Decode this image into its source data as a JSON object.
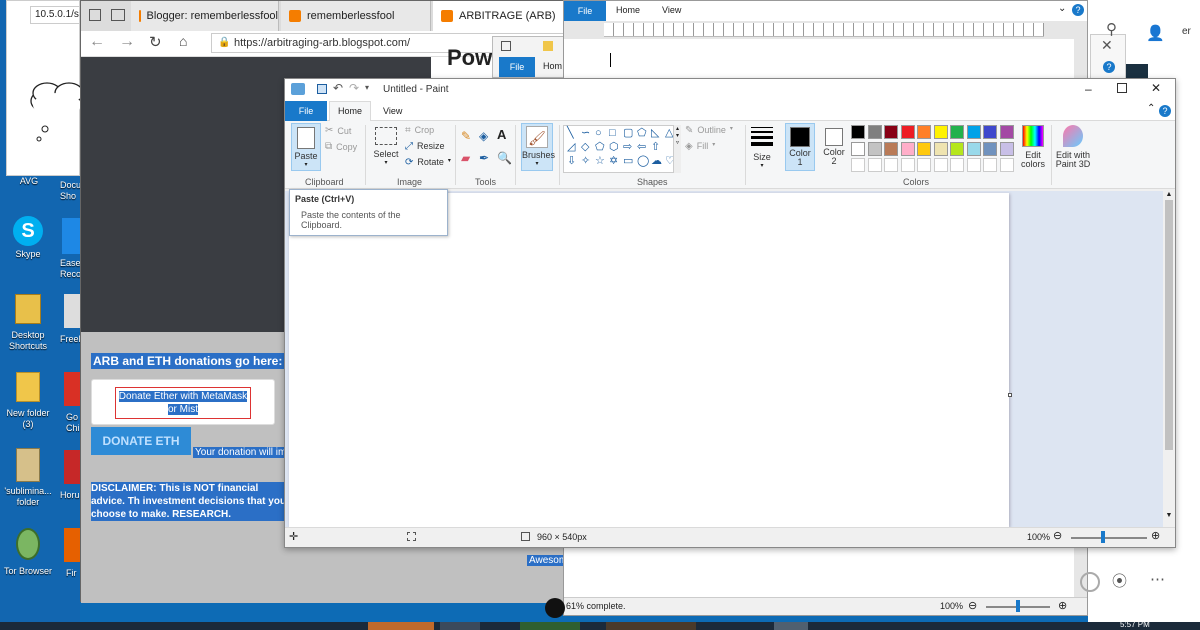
{
  "desktop": {
    "icons": [
      {
        "label": "AVG"
      },
      {
        "label": "Skype"
      },
      {
        "label": "Desktop\nShortcuts"
      },
      {
        "label": "New folder\n(3)"
      },
      {
        "label": "'sublimina...\nfolder"
      },
      {
        "label": "Tor Browser"
      }
    ],
    "partial_labels": [
      "Docu\nSho",
      "EaseU\nReco",
      "FreeF",
      "Go\nChi",
      "Horu",
      "Fir"
    ]
  },
  "browser": {
    "address_partial": "10.5.0.1/st",
    "tabs": [
      {
        "label": "Blogger: rememberlessfool"
      },
      {
        "label": "rememberlessfool"
      },
      {
        "label": "ARBITRAGE (ARB)"
      }
    ],
    "url": "https://arbitraging-arb.blogspot.com/",
    "heading_partial": "Pow",
    "donate_heading": "ARB and ETH donations go here: 0x",
    "metamask_button": "Donate Ether with MetaMask or Mist",
    "donate_eth": "DONATE ETH",
    "donation_note": "Your donation will imp",
    "disclaimer": "DISCLAIMER: This is NOT financial advice. Th investment decisions that you choose to make. RESEARCH.",
    "awesome_partial": "Awesom"
  },
  "word": {
    "tabs": [
      {
        "label": "File"
      },
      {
        "label": "Home"
      },
      {
        "label": "View"
      }
    ],
    "status": "61% complete.",
    "zoom": "100%"
  },
  "paint_small": {
    "tabs": [
      {
        "label": "File"
      },
      {
        "label": "Hom"
      }
    ]
  },
  "paint": {
    "title": "Untitled - Paint",
    "tabs": [
      {
        "label": "File"
      },
      {
        "label": "Home"
      },
      {
        "label": "View"
      }
    ],
    "clipboard": {
      "paste": "Paste",
      "cut": "Cut",
      "copy": "Copy",
      "group": "Clipboard"
    },
    "image": {
      "select": "Select",
      "crop": "Crop",
      "resize": "Resize",
      "rotate": "Rotate",
      "group": "Image"
    },
    "tools_group": "Tools",
    "brushes": "Brushes",
    "shapes": {
      "outline": "Outline",
      "fill": "Fill",
      "group": "Shapes"
    },
    "size": "Size",
    "color1": "Color\n1",
    "color2": "Color\n2",
    "colors_group": "Colors",
    "edit_colors": "Edit\ncolors",
    "edit_paint3d": "Edit with\nPaint 3D",
    "palette": [
      "#000000",
      "#7f7f7f",
      "#880015",
      "#ed1c24",
      "#ff7f27",
      "#fff200",
      "#22b14c",
      "#00a2e8",
      "#3f48cc",
      "#a349a4",
      "#ffffff",
      "#c3c3c3",
      "#b97a57",
      "#ffaec9",
      "#ffc90e",
      "#efe4b0",
      "#b5e61d",
      "#99d9ea",
      "#7092be",
      "#c8bfe7"
    ],
    "tooltip_title": "Paste (Ctrl+V)",
    "tooltip_body": "Paste the contents of the Clipboard.",
    "canvas_size": "960 × 540px",
    "zoom": "100%"
  },
  "right_panel": {
    "partial": "er"
  },
  "taskbar": {
    "clock_partial": "5:57 PM"
  }
}
